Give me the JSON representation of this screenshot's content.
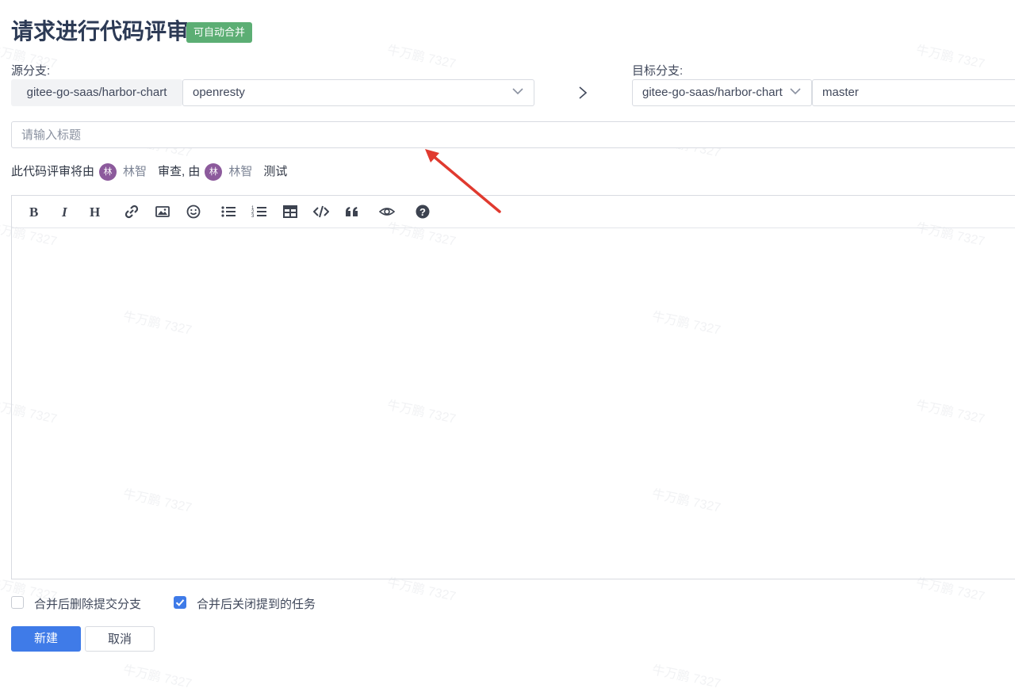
{
  "page": {
    "title": "请求进行代码评审",
    "badge": "可自动合并"
  },
  "source": {
    "label": "源分支:",
    "repo": "gitee-go-saas/harbor-chart",
    "branch": "openresty"
  },
  "target": {
    "label": "目标分支:",
    "repo": "gitee-go-saas/harbor-chart",
    "branch": "master"
  },
  "title_input": {
    "placeholder": "请输入标题",
    "value": ""
  },
  "reviewers": {
    "prefix": "此代码评审将由",
    "reviewer_avatar": "林",
    "reviewer_name": "林智",
    "middle": "审查, 由",
    "tester_avatar": "林",
    "tester_name": "林智",
    "suffix": "测试"
  },
  "editor": {
    "toolbar_icons": [
      "bold-icon",
      "italic-icon",
      "heading-icon",
      "link-icon",
      "image-icon",
      "emoji-icon",
      "bullet-list-icon",
      "numbered-list-icon",
      "table-icon",
      "code-icon",
      "quote-icon",
      "preview-eye-icon",
      "help-icon"
    ],
    "content": ""
  },
  "options": {
    "delete_branch_label": "合并后删除提交分支",
    "delete_branch_checked": false,
    "close_issues_label": "合并后关闭提到的任务",
    "close_issues_checked": true
  },
  "actions": {
    "create_label": "新建",
    "cancel_label": "取消"
  },
  "watermark": "牛万鹏 7327",
  "colors": {
    "badge": "#5cae74",
    "primary": "#3f7be8",
    "annotation_arrow": "#e03a2f",
    "avatar": "#8c5a9c"
  }
}
